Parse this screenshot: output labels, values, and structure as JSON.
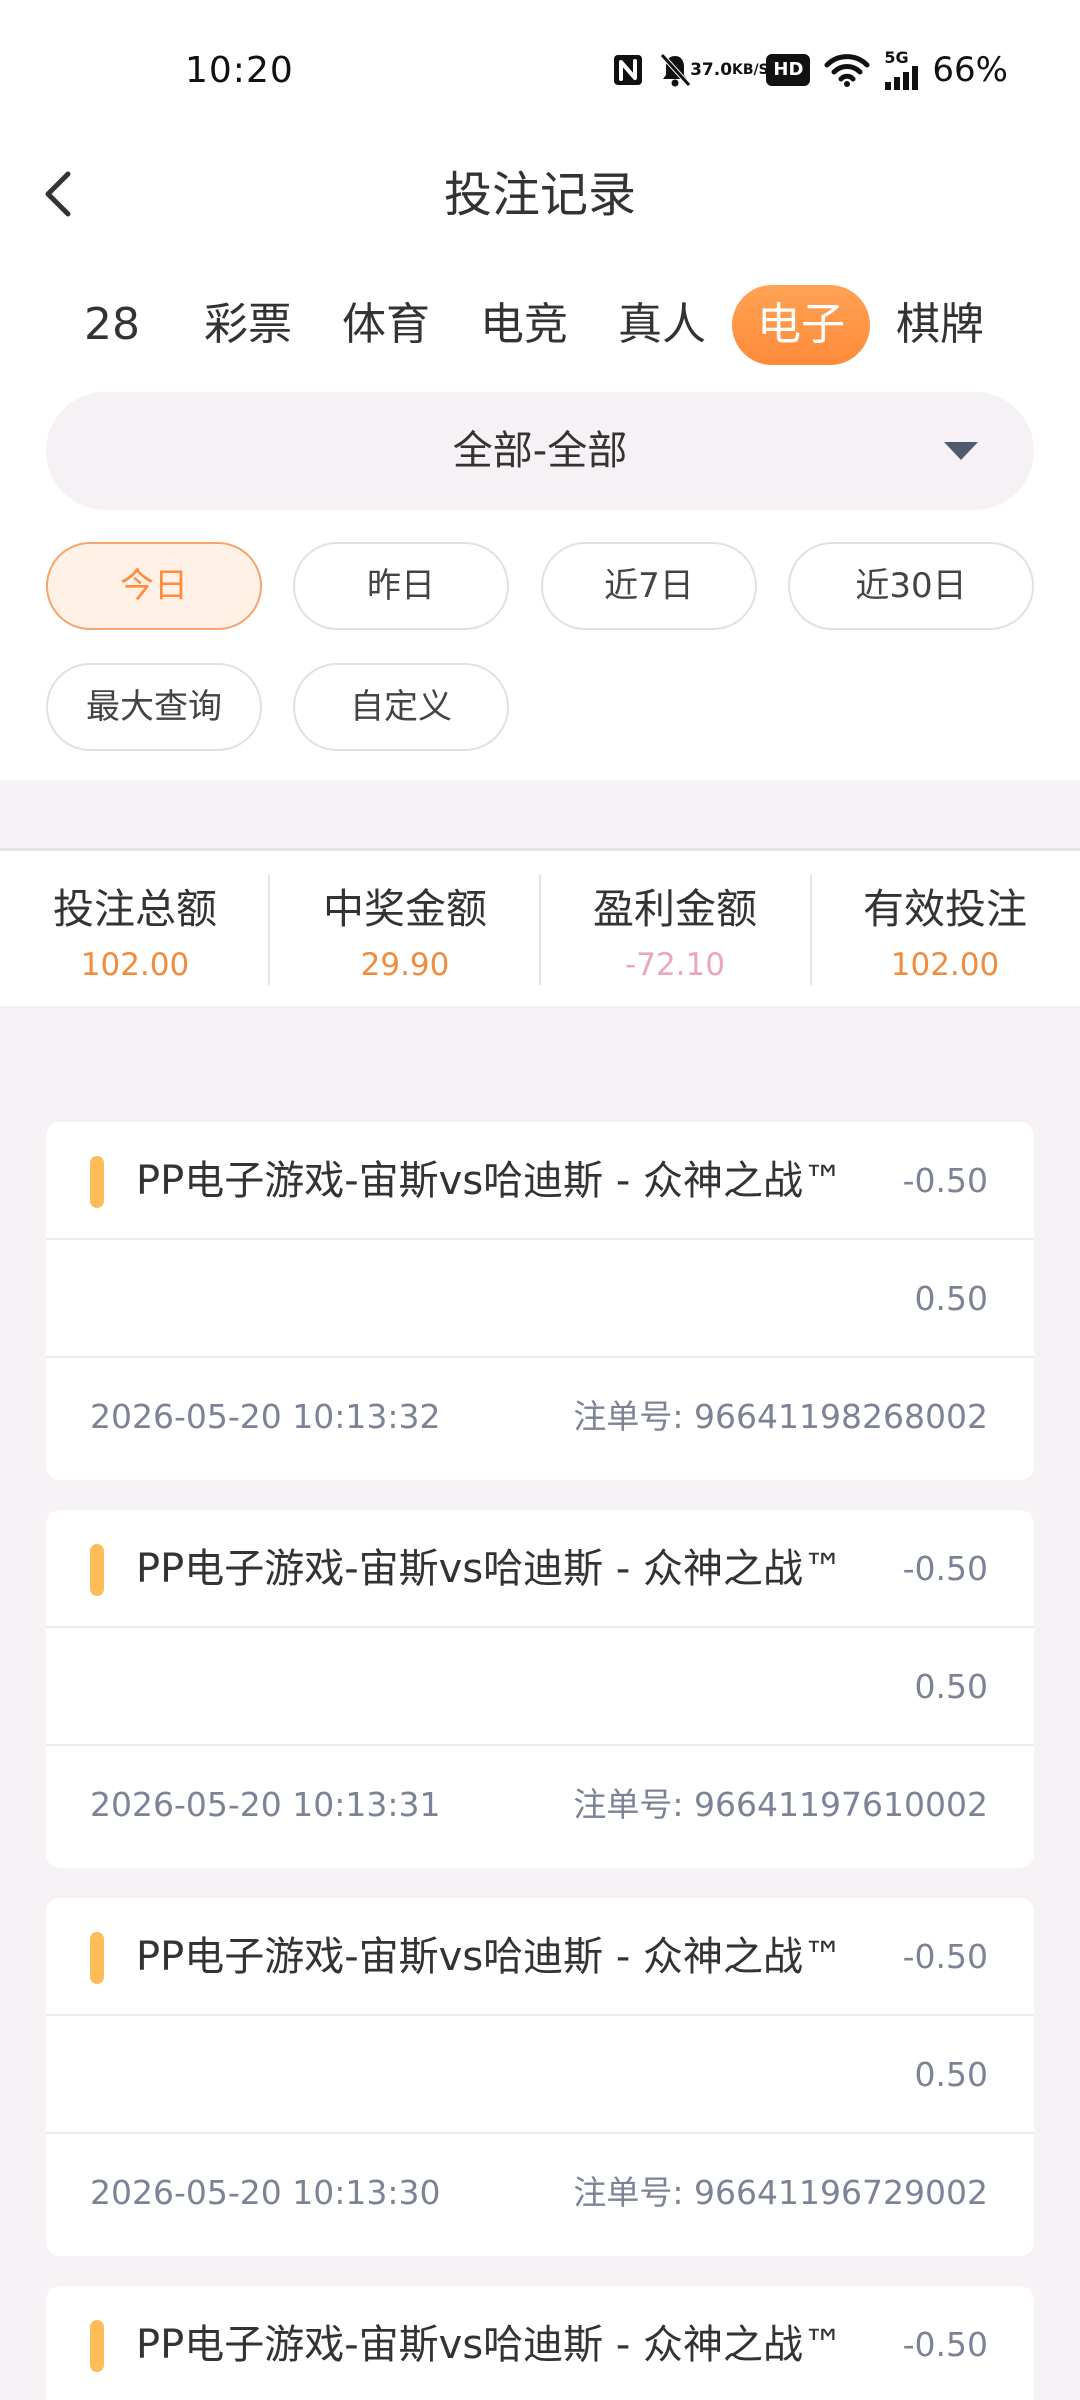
{
  "status_bar": {
    "time": "10:20",
    "net_speed_value": "37.0",
    "net_speed_unit": "KB/S",
    "hd": "HD",
    "signal_label": "5G",
    "battery": "66%"
  },
  "header": {
    "title": "投注记录"
  },
  "category_tabs": [
    {
      "label": "28",
      "active": false
    },
    {
      "label": "彩票",
      "active": false
    },
    {
      "label": "体育",
      "active": false
    },
    {
      "label": "电竞",
      "active": false
    },
    {
      "label": "真人",
      "active": false
    },
    {
      "label": "电子",
      "active": true
    },
    {
      "label": "棋牌",
      "active": false
    }
  ],
  "filter": {
    "value": "全部-全部"
  },
  "date_filters": [
    {
      "label": "今日",
      "active": true
    },
    {
      "label": "昨日",
      "active": false
    },
    {
      "label": "近7日",
      "active": false
    },
    {
      "label": "近30日",
      "active": false
    },
    {
      "label": "最大查询",
      "active": false
    },
    {
      "label": "自定义",
      "active": false
    }
  ],
  "summary": [
    {
      "label": "投注总额",
      "value": "102.00",
      "color": "#f08c3e"
    },
    {
      "label": "中奖金额",
      "value": "29.90",
      "color": "#f08c3e"
    },
    {
      "label": "盈利金额",
      "value": "-72.10",
      "color": "#eaa6bd"
    },
    {
      "label": "有效投注",
      "value": "102.00",
      "color": "#f08c3e"
    }
  ],
  "records": [
    {
      "title": "PP电子游戏-宙斯vs哈迪斯 - 众神之战™",
      "profit": "-0.50",
      "bet": "0.50",
      "time": "2026-05-20 10:13:32",
      "order_label": "注单号:",
      "order_no": "96641198268002"
    },
    {
      "title": "PP电子游戏-宙斯vs哈迪斯 - 众神之战™",
      "profit": "-0.50",
      "bet": "0.50",
      "time": "2026-05-20 10:13:31",
      "order_label": "注单号:",
      "order_no": "96641197610002"
    },
    {
      "title": "PP电子游戏-宙斯vs哈迪斯 - 众神之战™",
      "profit": "-0.50",
      "bet": "0.50",
      "time": "2026-05-20 10:13:30",
      "order_label": "注单号:",
      "order_no": "96641196729002"
    },
    {
      "title": "PP电子游戏-宙斯vs哈迪斯 - 众神之战™",
      "profit": "-0.50"
    }
  ],
  "colors": {
    "accent": "#ff8b3b",
    "background": "#f7f2f5"
  }
}
